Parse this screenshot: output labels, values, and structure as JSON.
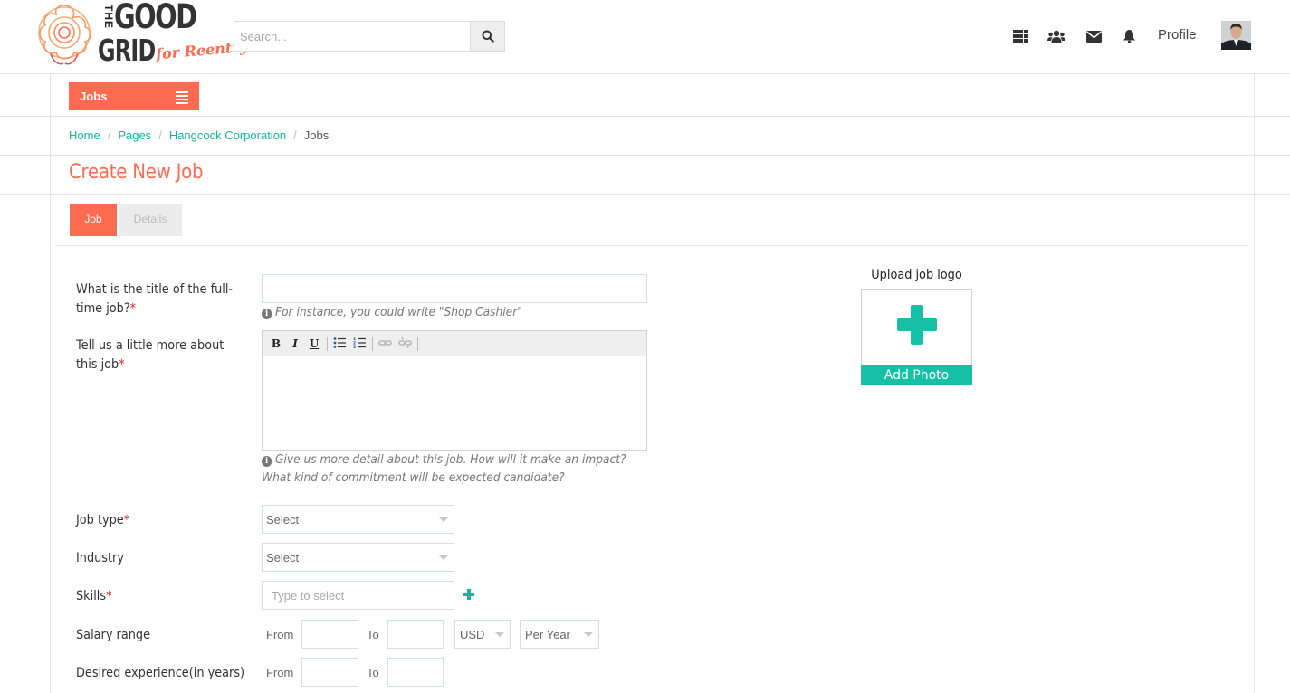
{
  "brand": {
    "logo_top_word": "THE",
    "logo_word_1": "GOOD",
    "logo_word_2": "GRID",
    "logo_tagline": "for Reentry",
    "accent_color": "#fe6b50",
    "teal_color": "#15b79e"
  },
  "header": {
    "search_placeholder": "Search...",
    "search_icon": "search-icon",
    "icons": [
      "apps-grid-icon",
      "users-icon",
      "envelope-icon",
      "bell-icon"
    ],
    "profile_label": "Profile"
  },
  "nav": {
    "jobs_label": "Jobs"
  },
  "breadcrumb": {
    "items": [
      "Home",
      "Pages",
      "Hangcock Corporation"
    ],
    "current": "Jobs",
    "separator": "/"
  },
  "page": {
    "title": "Create New Job"
  },
  "tabs": [
    {
      "label": "Job",
      "active": true
    },
    {
      "label": "Details",
      "active": false
    }
  ],
  "form": {
    "title_label": "What is the title of the full-time job?",
    "title_value": "",
    "title_hint": "For instance, you could write \"Shop Cashier\"",
    "desc_label": "Tell us a little more about this job",
    "desc_toolbar": {
      "bold": "B",
      "italic": "I",
      "underline": "U"
    },
    "desc_hint": "Give us more detail about this job. How will it make an impact? What kind of commitment will be expected candidate?",
    "job_type_label": "Job type",
    "job_type_value": "Select",
    "industry_label": "Industry",
    "industry_value": "Select",
    "skills_label": "Skills",
    "skills_placeholder": "Type to select",
    "salary_label": "Salary range",
    "salary_from_label": "From",
    "salary_to_label": "To",
    "salary_currency": "USD",
    "salary_period": "Per Year",
    "experience_label": "Desired experience(in years)",
    "experience_from_label": "From",
    "experience_to_label": "To",
    "required_mark": "*"
  },
  "upload": {
    "title": "Upload job logo",
    "button_label": "Add Photo"
  }
}
